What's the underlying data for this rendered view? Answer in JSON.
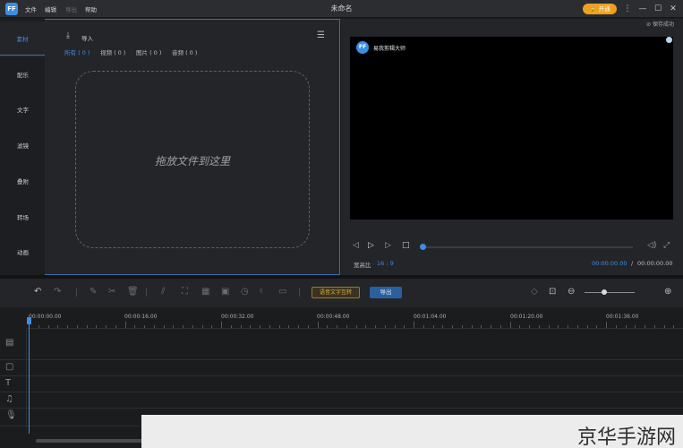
{
  "titlebar": {
    "app_logo": "FF",
    "menu": [
      "文件",
      "编辑",
      "导出",
      "帮助"
    ],
    "title": "未命名",
    "vip_label": "开通",
    "buttons": [
      "more-icon",
      "minimize-icon",
      "maximize-icon",
      "close-icon"
    ]
  },
  "sidebar": {
    "tabs": [
      "素材",
      "配乐",
      "文字",
      "滤镜",
      "叠附",
      "转场",
      "动画"
    ],
    "active_index": 0
  },
  "media": {
    "import_label": "导入",
    "filters": [
      "所有 ( 0 )",
      "视频 ( 0 )",
      "图片 ( 0 )",
      "音频 ( 0 )"
    ],
    "active_filter": 0,
    "drop_text": "拖放文件到这里"
  },
  "preview": {
    "save_status": "保存成功",
    "logo": "FF",
    "brand": "易我剪辑大师",
    "aspect_label": "宽高比",
    "aspect_value": "16 : 9",
    "time_current": "00:00:00.00",
    "time_separator": "/",
    "time_total": "00:00:00.00",
    "progress": 0
  },
  "toolbar": {
    "speech_button": "语音文字互转",
    "export_button": "导出",
    "zoom_level": 0.35
  },
  "timeline": {
    "ticks": [
      "00:00:00.00",
      "00:00:16.00",
      "00:00:32.00",
      "00:00:48.00",
      "00:01:04.00",
      "00:01:20.00",
      "00:01:36.00"
    ],
    "tracks": [
      "video-track-icon",
      "pip-track-icon",
      "text-track-icon",
      "music-track-icon",
      "voice-track-icon"
    ]
  },
  "watermark": {
    "text": "京华手游网"
  },
  "colors": {
    "accent": "#3a8ee6",
    "vip": "#f0a020",
    "background": "#1b1c1e"
  }
}
